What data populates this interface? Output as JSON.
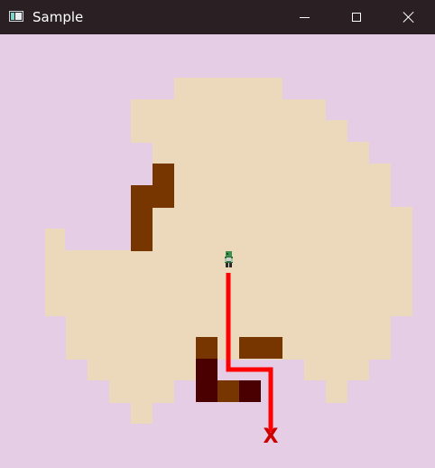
{
  "window": {
    "title": "Sample",
    "icons": {
      "app": "app-window-icon",
      "minimize": "minimize-icon",
      "maximize": "maximize-icon",
      "close": "close-icon"
    }
  },
  "game": {
    "colors": {
      "background": "#e6cde6",
      "floor": "#ecd8bb",
      "wall": "#773500",
      "dark_wall": "#4a0000",
      "path": "#ff0000",
      "target": "#cc0000",
      "player_body": "#3f8f4f"
    },
    "player": {
      "icon": "player-character-icon"
    },
    "target": {
      "icon": "target-x-icon",
      "label": "X"
    }
  }
}
